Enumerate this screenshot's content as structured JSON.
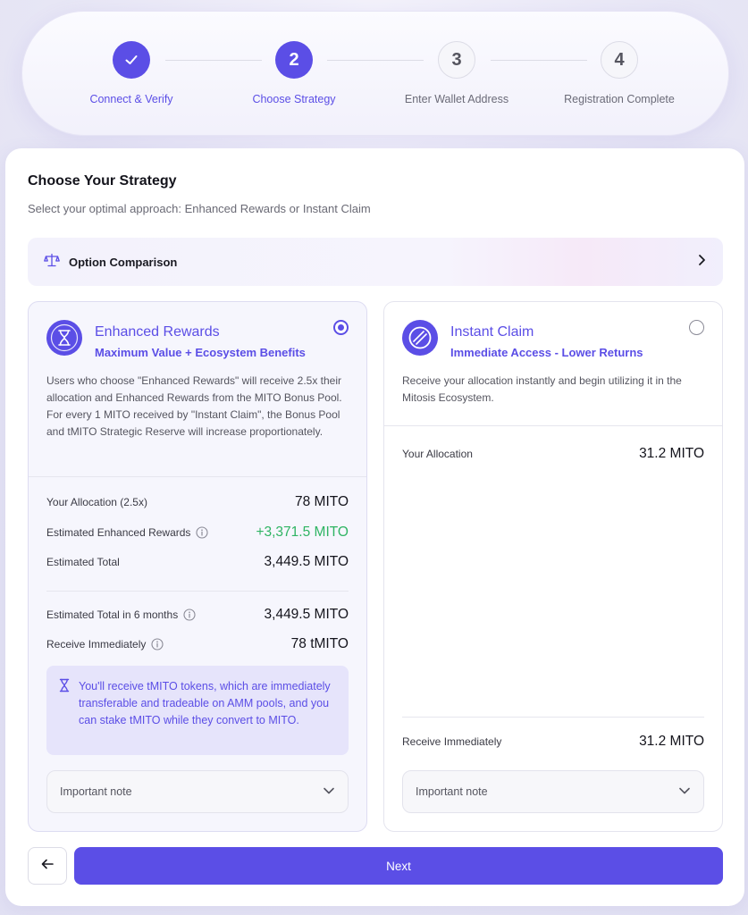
{
  "stepper": {
    "steps": [
      {
        "number": "1",
        "label": "Connect & Verify",
        "status": "done"
      },
      {
        "number": "2",
        "label": "Choose Strategy",
        "status": "active"
      },
      {
        "number": "3",
        "label": "Enter Wallet Address",
        "status": "pending"
      },
      {
        "number": "4",
        "label": "Registration Complete",
        "status": "pending"
      }
    ]
  },
  "page": {
    "title": "Choose Your Strategy",
    "subtitle": "Select your optimal approach: Enhanced Rewards or Instant Claim"
  },
  "comparison": {
    "label": "Option Comparison",
    "icon": "scale-icon"
  },
  "enhanced": {
    "selected": true,
    "title": "Enhanced Rewards",
    "subtitle": "Maximum Value + Ecosystem Benefits",
    "icon": "hourglass-icon",
    "description": "Users who choose \"Enhanced Rewards\" will receive 2.5x their allocation and Enhanced Rewards from the MITO Bonus Pool. For every 1 MITO received by \"Instant Claim\", the Bonus Pool and tMITO Strategic Reserve will increase proportionately.",
    "rows": [
      {
        "label": "Your Allocation (2.5x)",
        "value": "78 MITO"
      },
      {
        "label": "Estimated Enhanced Rewards",
        "value": "+3,371.5 MITO"
      },
      {
        "label": "Estimated Total",
        "value": "3,449.5 MITO"
      },
      {
        "label": "Estimated Total in 6 months",
        "value": "3,449.5 MITO"
      },
      {
        "label": "Receive Immediately",
        "value": "78 tMITO"
      }
    ],
    "notice": "You'll receive tMITO tokens, which are immediately transferable and tradeable on AMM pools, and you can stake tMITO while they convert to MITO.",
    "dropdown_label": "Important note"
  },
  "instant": {
    "selected": false,
    "title": "Instant Claim",
    "subtitle": "Immediate Access - Lower Returns",
    "icon": "lightning-disc-icon",
    "description": "Receive your allocation instantly and begin utilizing it in the Mitosis Ecosystem.",
    "rows": [
      {
        "label": "Your Allocation",
        "value": "31.2 MITO"
      },
      {
        "label": "Receive Immediately",
        "value": "31.2 MITO"
      }
    ],
    "dropdown_label": "Important note"
  },
  "footer": {
    "back_icon": "arrow-left-icon",
    "next_label": "Next"
  },
  "colors": {
    "accent": "#5b4ee6",
    "positive": "#2fb463"
  }
}
